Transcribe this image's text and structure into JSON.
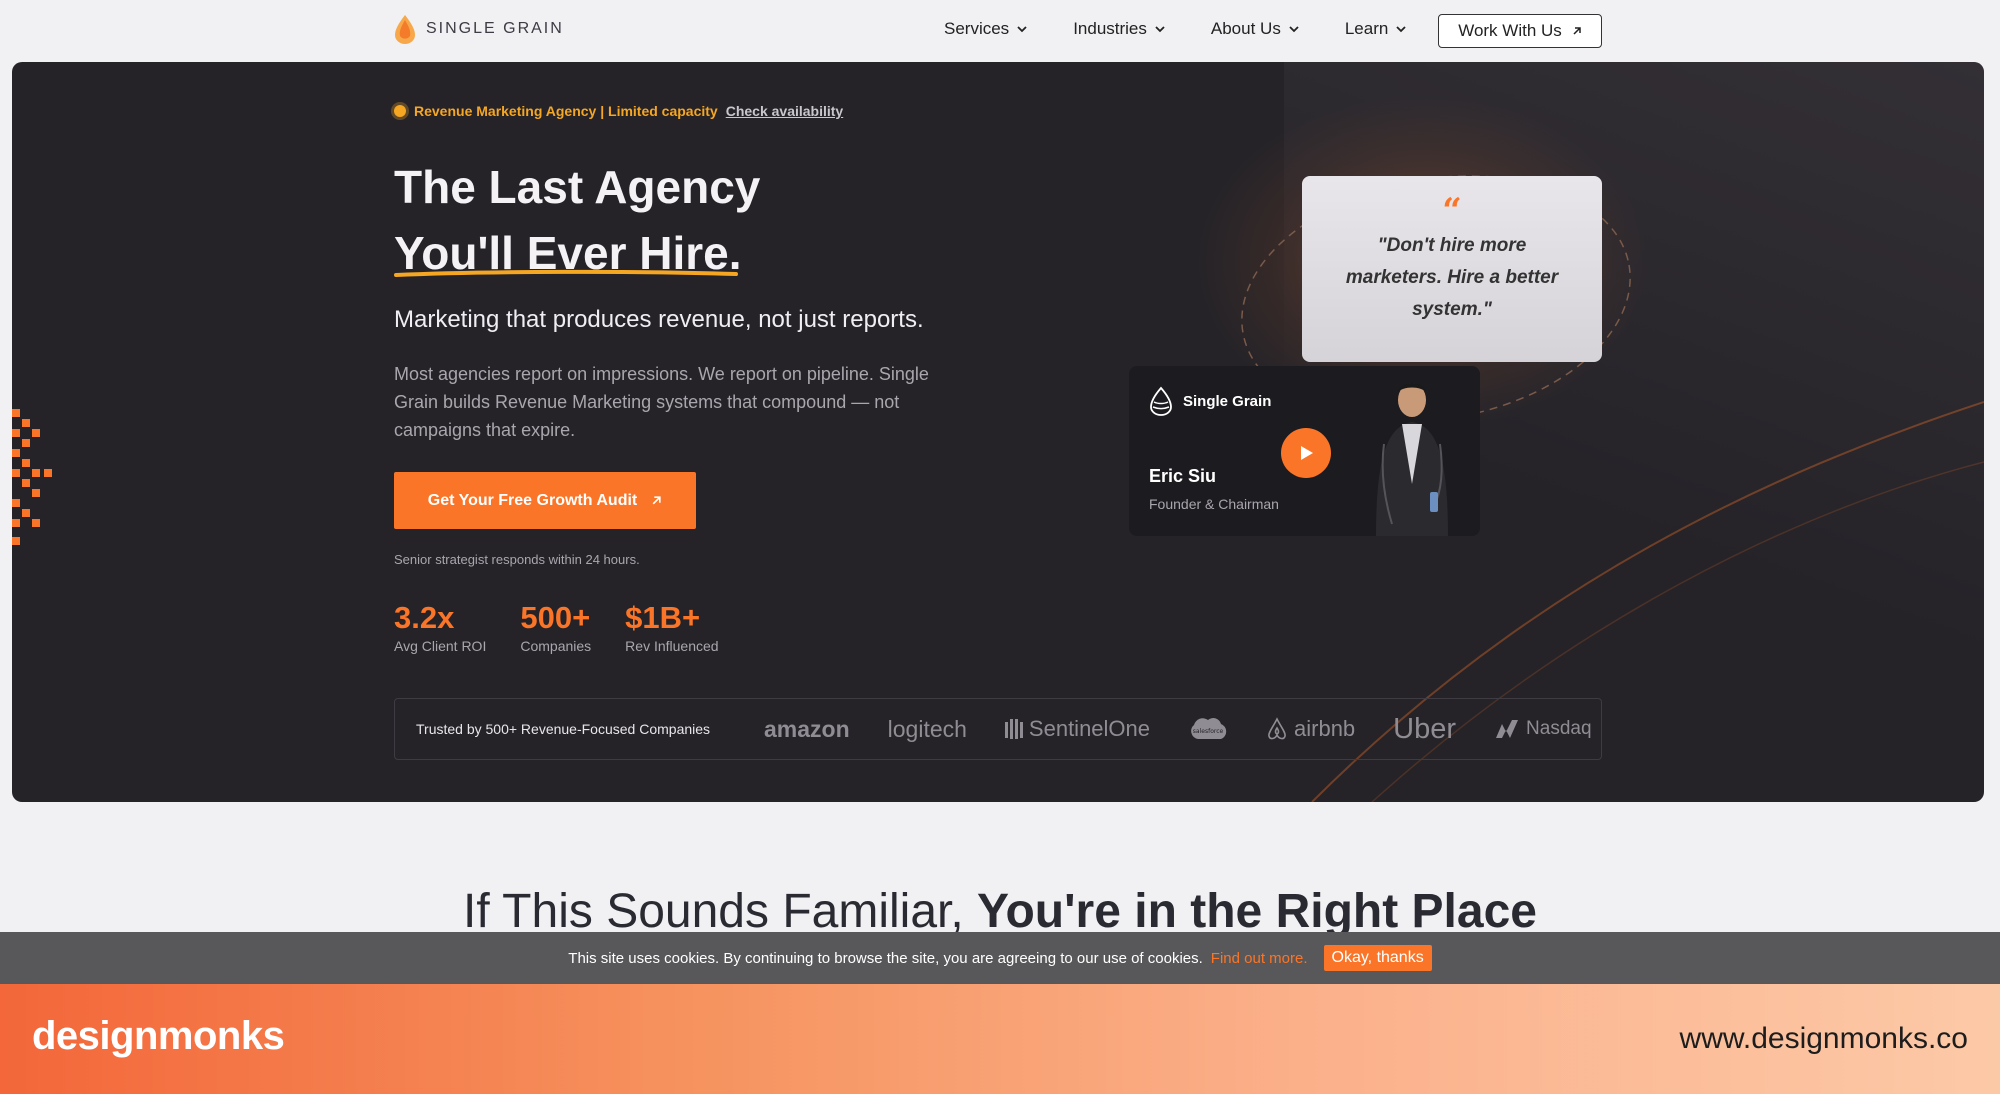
{
  "nav": {
    "logo_text": "SINGLE GRAIN",
    "menu": [
      {
        "label": "Services"
      },
      {
        "label": "Industries"
      },
      {
        "label": "About Us"
      },
      {
        "label": "Learn"
      }
    ],
    "cta_label": "Work With Us"
  },
  "hero": {
    "tag_text": "Revenue Marketing Agency | Limited capacity",
    "tag_link": "Check availability",
    "title_line1": "The Last Agency",
    "title_line2": "You'll Ever Hire.",
    "subtitle": "Marketing that produces revenue, not just reports.",
    "paragraph": "Most agencies report on impressions. We report on pipeline. Single Grain builds Revenue Marketing systems that compound — not campaigns that expire.",
    "cta_label": "Get Your Free Growth Audit",
    "note": "Senior strategist responds within 24 hours.",
    "stats": [
      {
        "value": "3.2x",
        "label": "Avg Client ROI"
      },
      {
        "value": "500+",
        "label": "Companies"
      },
      {
        "value": "$1B+",
        "label": "Rev Influenced"
      }
    ],
    "trusted_text": "Trusted by 500+ Revenue-Focused Companies",
    "brands": [
      "amazon",
      "logitech",
      "SentinelOne",
      "salesforce",
      "airbnb",
      "Uber",
      "Nasdaq"
    ],
    "quote": "\"Don't hire more marketers. Hire a better system.\"",
    "video": {
      "brand": "Single Grain",
      "name": "Eric Siu",
      "role": "Founder & Chairman"
    }
  },
  "section": {
    "heading_light": "If This Sounds Familiar, ",
    "heading_bold": "You're in the Right Place"
  },
  "cookie": {
    "text": "This site uses cookies. By continuing to browse the site, you are agreeing to our use of cookies.",
    "link": "Find out more.",
    "button": "Okay, thanks"
  },
  "footer": {
    "logo": "designmonks",
    "url": "www.designmonks.co"
  },
  "colors": {
    "accent": "#fa7527",
    "hero_bg": "#252328",
    "tag": "#f5a623"
  }
}
